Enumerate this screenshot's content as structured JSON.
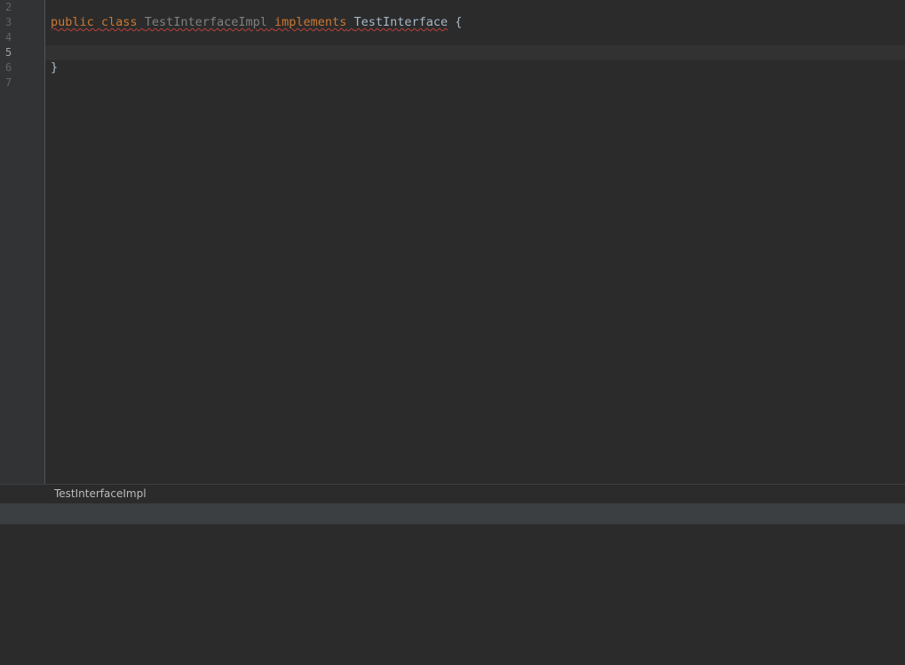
{
  "editor": {
    "line_numbers": [
      "2",
      "3",
      "4",
      "5",
      "6",
      "7"
    ],
    "current_line": "5",
    "code": {
      "line3": {
        "public_kw": "public",
        "class_kw": "class",
        "class_name": "TestInterfaceImpl",
        "implements_kw": "implements",
        "interface_name": "TestInterface",
        "open_brace": "{"
      },
      "line6": {
        "close_brace": "}"
      }
    }
  },
  "breadcrumb": {
    "item": "TestInterfaceImpl"
  },
  "colors": {
    "background": "#2b2b2b",
    "gutter": "#313335",
    "keyword": "#cc7832",
    "text": "#a9b7c6",
    "unused": "#808080",
    "error_underline": "#bc3f3c",
    "caret_row": "#323232"
  }
}
